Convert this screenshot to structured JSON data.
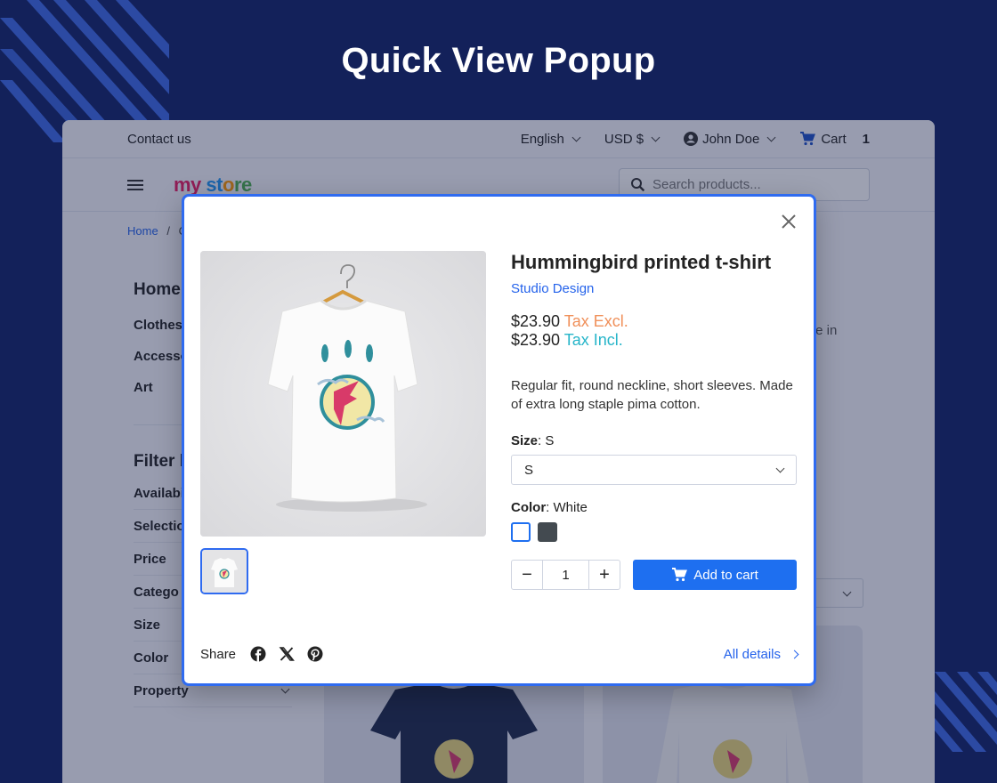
{
  "banner": {
    "title": "Quick View Popup"
  },
  "topbar": {
    "contact": "Contact us",
    "language": "English",
    "currency": "USD $",
    "user": "John Doe",
    "cart_label": "Cart",
    "cart_count": "1"
  },
  "header": {
    "logo": {
      "part1": "my",
      "part2": "st",
      "part3": "o",
      "part4": "re"
    },
    "search_placeholder": "Search products..."
  },
  "breadcrumb": {
    "home": "Home",
    "sep": "/",
    "next": "C"
  },
  "sidebar": {
    "heading": "Home",
    "items": [
      {
        "label": "Clothes"
      },
      {
        "label": "Accesso"
      },
      {
        "label": "Art"
      }
    ],
    "filter_heading": "Filter b",
    "filters": [
      {
        "label": "Availabi"
      },
      {
        "label": "Selectio"
      },
      {
        "label": "Price"
      },
      {
        "label": "Catego"
      },
      {
        "label": "Size"
      },
      {
        "label": "Color"
      },
      {
        "label": "Property"
      }
    ]
  },
  "background_text": {
    "line1": "te in",
    "line2": "."
  },
  "modal": {
    "product_title": "Hummingbird printed t-shirt",
    "brand": "Studio Design",
    "price_excl": "$23.90",
    "tax_excl_label": "Tax Excl.",
    "price_incl": "$23.90",
    "tax_incl_label": "Tax Incl.",
    "description": "Regular fit, round neckline, short sleeves. Made of extra long staple pima cotton.",
    "size_label": "Size",
    "size_value": ": S",
    "size_selected": "S",
    "color_label": "Color",
    "color_value": ": White",
    "colors": [
      "#ffffff",
      "#434a50"
    ],
    "quantity": "1",
    "qty_minus": "−",
    "qty_plus": "+",
    "add_to_cart": "Add to cart",
    "share_label": "Share",
    "all_details": "All details"
  },
  "colors": {
    "accent": "#1e6ff0",
    "banner_bg": "#13215a",
    "tax_excl": "#f0905a",
    "tax_incl": "#26b5c9"
  }
}
